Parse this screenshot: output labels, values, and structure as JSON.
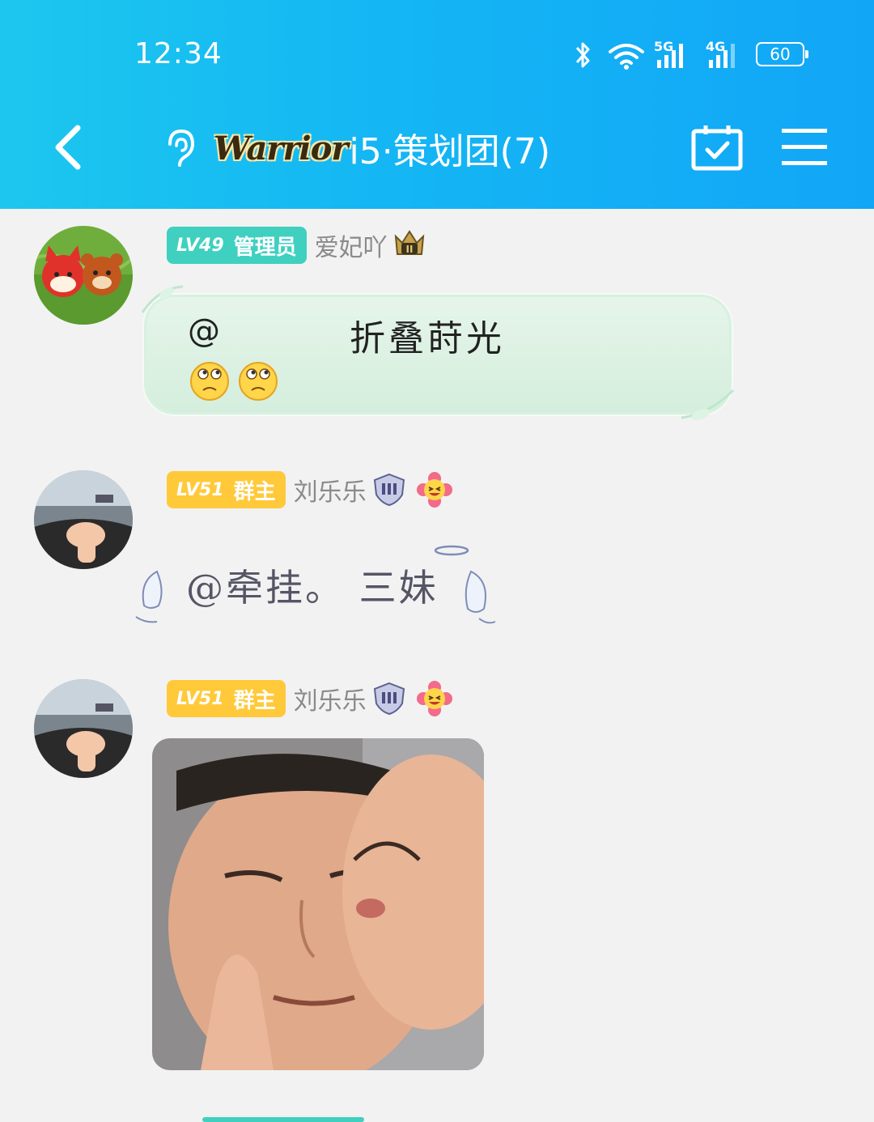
{
  "status_bar": {
    "time": "12:34",
    "network_5g": "5G",
    "network_4g": "4G",
    "battery": "60",
    "icons": [
      "bluetooth-icon",
      "wifi-icon",
      "signal-5g-icon",
      "signal-4g-icon",
      "battery-icon"
    ]
  },
  "header": {
    "logo_text": "Warrior",
    "title": "i5·策划团(7)",
    "icons": [
      "back-arrow-icon",
      "ear-icon",
      "calendar-check-icon",
      "menu-icon"
    ]
  },
  "messages": [
    {
      "badge_level": "LV49",
      "badge_role": "管理员",
      "badge_color": "#3fd0c0",
      "nickname": "爱妃吖",
      "at_symbol": "@",
      "mention": "折叠莳光",
      "emojis": [
        "thinking-face-icon",
        "thinking-face-icon"
      ]
    },
    {
      "badge_level": "LV51",
      "badge_role": "群主",
      "badge_color": "#ffc93a",
      "nickname": "刘乐乐",
      "text": "@牵挂。 三妹"
    },
    {
      "badge_level": "LV51",
      "badge_role": "群主",
      "badge_color": "#ffc93a",
      "nickname": "刘乐乐",
      "content": "image"
    }
  ],
  "colors": {
    "header_gradient_start": "#1cc7ee",
    "header_gradient_end": "#12a6f7",
    "background": "#f2f2f2"
  }
}
